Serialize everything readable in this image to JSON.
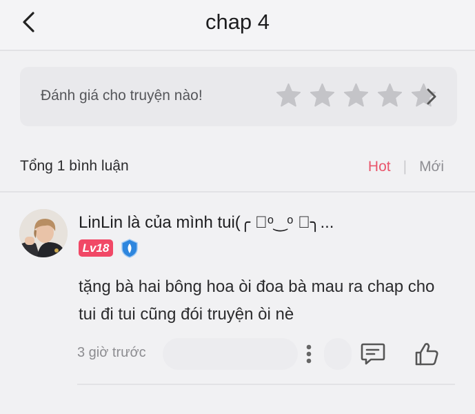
{
  "header": {
    "title": "chap 4"
  },
  "rating": {
    "prompt": "Đánh giá cho truyện nào!",
    "stars_total": 5,
    "stars_filled": 0
  },
  "comments": {
    "total_label": "Tổng 1 bình luận",
    "sort": {
      "hot_label": "Hot",
      "separator": "|",
      "new_label": "Mới",
      "active": "Hot"
    },
    "items": [
      {
        "username": "LinLin là của mình tui(╭ ⃘ᵒ‿ᵒ ⃘╮...",
        "level_badge": "Lv18",
        "text": "tặng bà hai bông hoa òi đoa bà mau ra chap cho tui đi tui cũng đói truyện òi nè",
        "time": "3 giờ trước"
      }
    ]
  },
  "colors": {
    "accent": "#e9566c",
    "level_badge": "#f14866",
    "shield_badge": "#2e86de",
    "star_empty": "#c4c4c8"
  }
}
